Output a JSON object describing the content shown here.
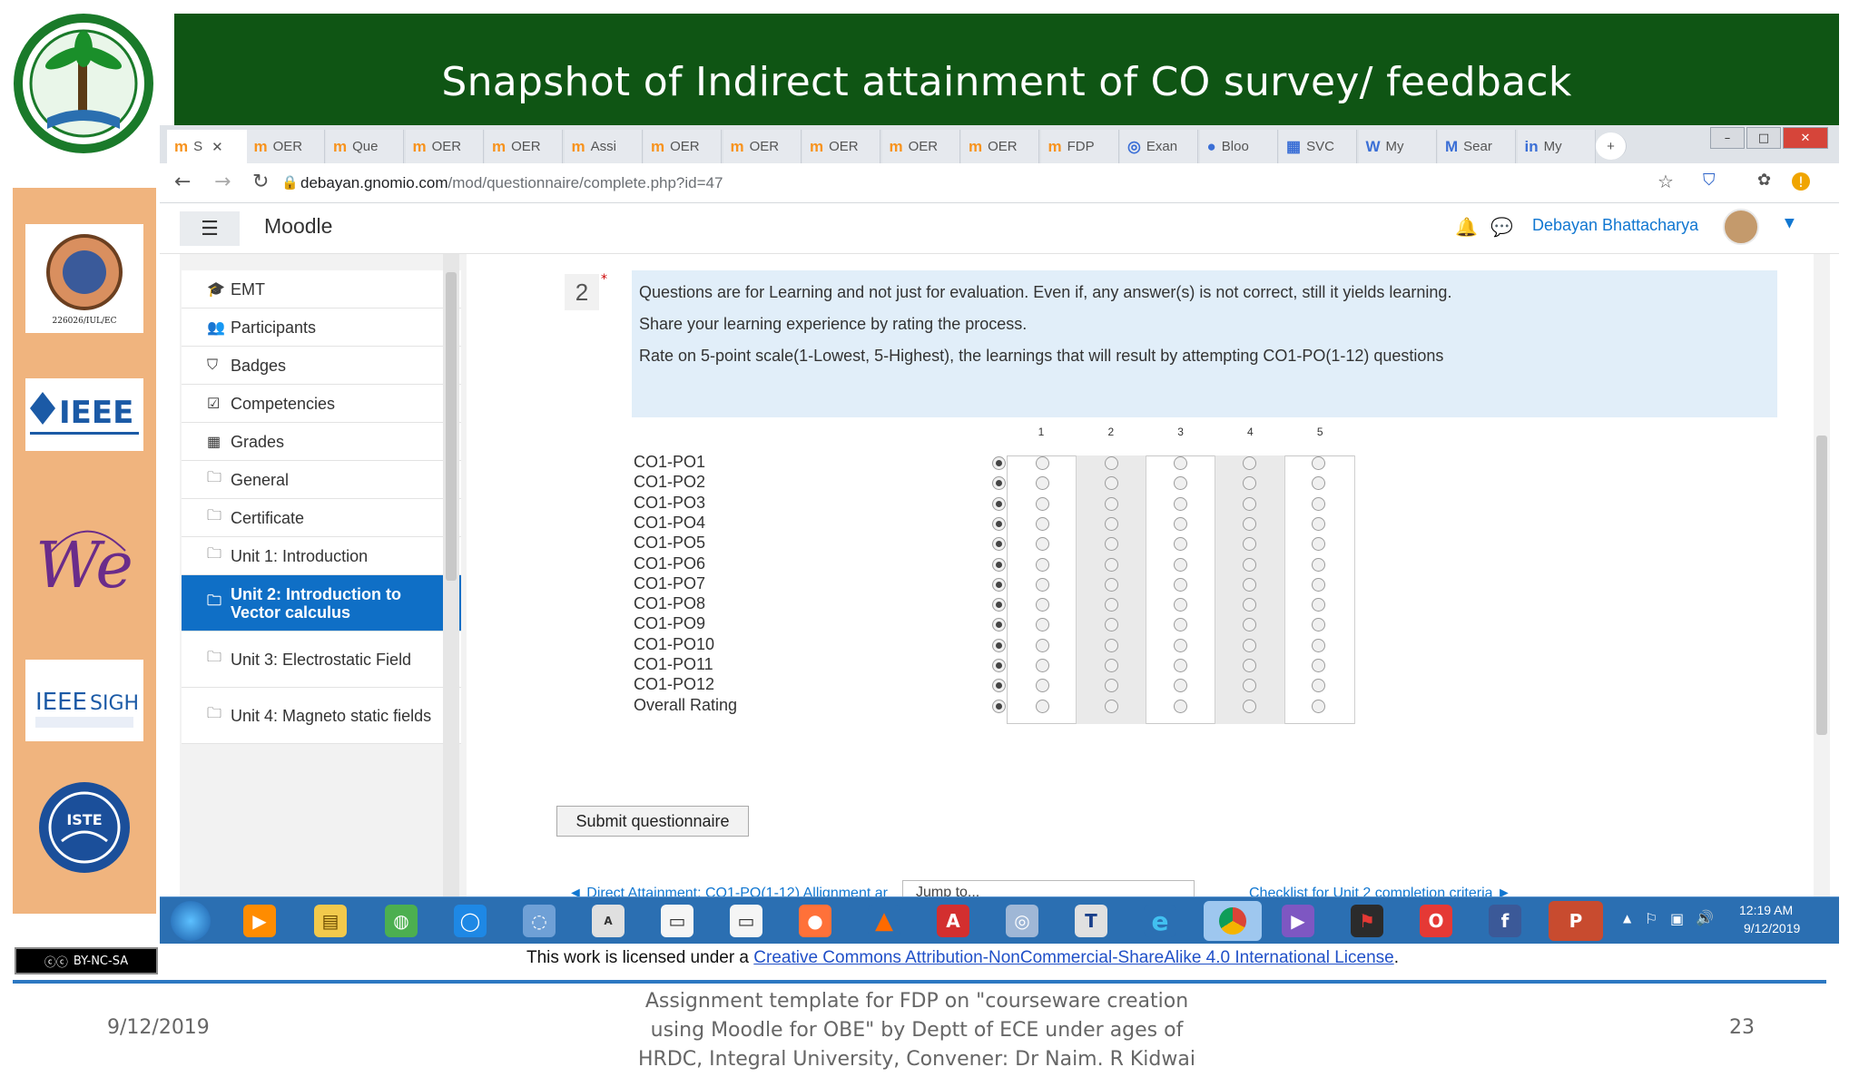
{
  "slide": {
    "title": "Snapshot of Indirect attainment of CO survey/ feedback",
    "footer_date": "9/12/2019",
    "footer_note": "Assignment template for FDP on \"courseware creation using Moodle for OBE\"  by Deptt of ECE under ages of HRDC, Integral University,  Convener: Dr Naim. R Kidwai",
    "page_number": "23",
    "license_prefix": "This work is licensed under a ",
    "license_link": "Creative Commons Attribution-NonCommercial-ShareAlike 4.0 International License",
    "license_suffix": ".",
    "cc_badge": "BY-NC-SA",
    "side_logos": [
      "226026/IUL/EC",
      "IEEE",
      "IEEE Women in Engineering",
      "IEEE SIGHT",
      "ISTE"
    ]
  },
  "browser": {
    "tabs": [
      {
        "icon": "m",
        "label": "S"
      },
      {
        "icon": "m",
        "label": "OER"
      },
      {
        "icon": "m",
        "label": "Que"
      },
      {
        "icon": "m",
        "label": "OER"
      },
      {
        "icon": "m",
        "label": "OER"
      },
      {
        "icon": "m",
        "label": "Assi"
      },
      {
        "icon": "m",
        "label": "OER"
      },
      {
        "icon": "m",
        "label": "OER"
      },
      {
        "icon": "m",
        "label": "OER"
      },
      {
        "icon": "m",
        "label": "OER"
      },
      {
        "icon": "m",
        "label": "OER"
      },
      {
        "icon": "m",
        "label": "FDP"
      },
      {
        "icon": "◎",
        "label": "Exan"
      },
      {
        "icon": "●",
        "label": "Bloo"
      },
      {
        "icon": "▦",
        "label": "SVC"
      },
      {
        "icon": "W",
        "label": "My"
      },
      {
        "icon": "M",
        "label": "Sear"
      },
      {
        "icon": "in",
        "label": "My"
      }
    ],
    "url_host": "debayan.gnomio.com",
    "url_path": "/mod/questionnaire/complete.php?id=47"
  },
  "moodle": {
    "brand": "Moodle",
    "user_name": "Debayan Bhattacharya"
  },
  "nav": [
    {
      "icon": "🎓",
      "label": "EMT",
      "active": false
    },
    {
      "icon": "👥",
      "label": "Participants",
      "active": false
    },
    {
      "icon": "⛉",
      "label": "Badges",
      "active": false
    },
    {
      "icon": "☑",
      "label": "Competencies",
      "active": false
    },
    {
      "icon": "▦",
      "label": "Grades",
      "active": false
    },
    {
      "icon": "🗀",
      "label": "General",
      "active": false
    },
    {
      "icon": "🗀",
      "label": "Certificate",
      "active": false
    },
    {
      "icon": "🗀",
      "label": "Unit 1: Introduction",
      "active": false
    },
    {
      "icon": "🗀",
      "label": "Unit 2: Introduction to Vector calculus",
      "active": true
    },
    {
      "icon": "🗀",
      "label": "Unit 3: Electrostatic Field",
      "active": false
    },
    {
      "icon": "🗀",
      "label": "Unit 4: Magneto static fields",
      "active": false
    }
  ],
  "question": {
    "number": "2",
    "required_mark": "*",
    "lines": [
      "Questions are for Learning and not just for evaluation. Even if, any answer(s) is not correct, still it yields learning.",
      "Share your learning experience by rating the process.",
      "Rate on 5-point scale(1-Lowest, 5-Highest), the learnings that will result by attempting CO1-PO(1-12) questions"
    ],
    "scale": [
      "1",
      "2",
      "3",
      "4",
      "5"
    ],
    "rows": [
      "CO1-PO1",
      "CO1-PO2",
      "CO1-PO3",
      "CO1-PO4",
      "CO1-PO5",
      "CO1-PO6",
      "CO1-PO7",
      "CO1-PO8",
      "CO1-PO9",
      "CO1-PO10",
      "CO1-PO11",
      "CO1-PO12",
      "Overall Rating"
    ],
    "submit_label": "Submit questionnaire",
    "prev_link": "◄ Direct Attainment: CO1-PO(1-12) Allignment ar",
    "jump_placeholder": "Jump to...",
    "next_link": "Checklist for Unit 2 completion criteria ►"
  },
  "taskbar": {
    "time": "12:19 AM",
    "date": "9/12/2019"
  }
}
